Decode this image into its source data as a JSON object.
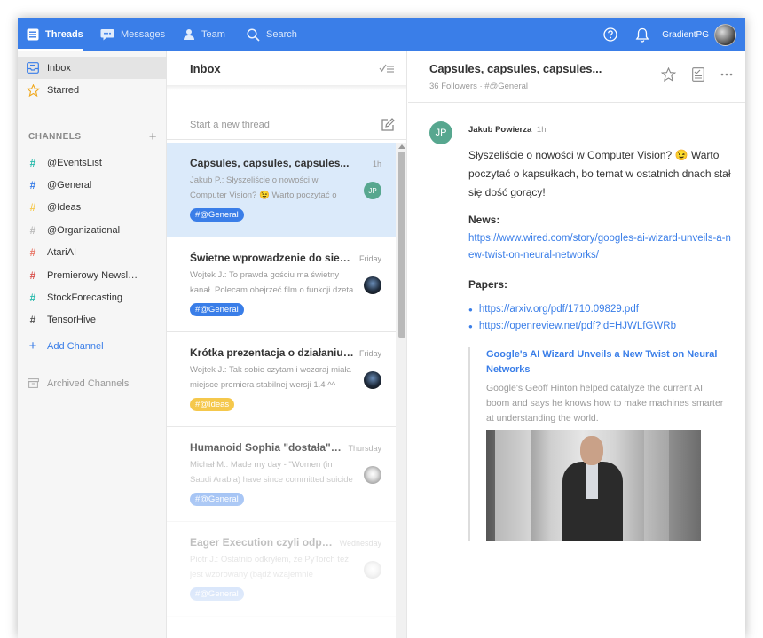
{
  "topbar": {
    "nav": [
      {
        "label": "Threads",
        "icon": "threads-icon",
        "active": true
      },
      {
        "label": "Messages",
        "icon": "messages-icon",
        "active": false
      },
      {
        "label": "Team",
        "icon": "team-icon",
        "active": false
      },
      {
        "label": "Search",
        "icon": "search-icon",
        "active": false
      }
    ],
    "user_name": "GradientPG",
    "icons": [
      "help-icon",
      "bell-icon",
      "avatar"
    ]
  },
  "sidebar": {
    "inbox": "Inbox",
    "starred": "Starred",
    "channels_header": "CHANNELS",
    "channels": [
      {
        "name": "@EventsList",
        "color": "#2bbbad"
      },
      {
        "name": "@General",
        "color": "#3a7ee8"
      },
      {
        "name": "@Ideas",
        "color": "#f5c84c"
      },
      {
        "name": "@Organizational",
        "color": "#bbbbbb"
      },
      {
        "name": "AtariAI",
        "color": "#e8796a"
      },
      {
        "name": "Premierowy Newsl…",
        "color": "#d9534f"
      },
      {
        "name": "StockForecasting",
        "color": "#2bbbad"
      },
      {
        "name": "TensorHive",
        "color": "#555555"
      }
    ],
    "add_channel": "Add Channel",
    "archived": "Archived Channels"
  },
  "threadlist": {
    "title": "Inbox",
    "new_thread_placeholder": "Start a new thread",
    "threads": [
      {
        "title": "Capsules, capsules, capsules...",
        "time": "1h",
        "preview_a": "Jakub P.: Słyszeliście o nowości w Computer Vision?",
        "emoji": "😉",
        "preview_b": " Warto poczytać o",
        "tag": "#@General",
        "avatar": "JP"
      },
      {
        "title": "Świetne wprowadzenie do sieci …",
        "time": "Friday",
        "preview_a": "Wojtek J.: To prawda gościu ma świetny kanał. Polecam obejrzeć film o funkcji dzeta",
        "tag": "#@General"
      },
      {
        "title": "Krótka prezentacja o działaniu TF",
        "time": "Friday",
        "preview_a": "Wojtek J.: Tak sobie czytam i wczoraj miała miejsce premiera stabilnej wersji 1.4 ^^",
        "tag": "#@Ideas"
      },
      {
        "title": "Humanoid Sophia \"dostała\" …",
        "time": "Thursday",
        "preview_a": "Michał M.: Made my day - \"Women (in Saudi Arabia) have since committed suicide",
        "tag": "#@General"
      },
      {
        "title": "Eager Execution czyli odpo…",
        "time": "Wednesday",
        "preview_a": "Piotr J.: Ostatnio odkryłem, że PyTorch też jest wzorowany (bądź wzajemnie",
        "tag": "#@General"
      }
    ]
  },
  "detail": {
    "title": "Capsules, capsules, capsules...",
    "followers": "36 Followers · #@General",
    "message": {
      "avatar": "JP",
      "author": "Jakub Powierza",
      "time": "1h",
      "text_a": "Słyszeliście o nowości w Computer Vision?",
      "emoji": "😉",
      "text_b": " Warto poczytać o kapsułkach, bo temat w ostatnich dnach stał się dość gorący!",
      "news_title": "News:",
      "news_link": "https://www.wired.com/story/googles-ai-wizard-unveils-a-new-twist-on-neural-networks/",
      "papers_title": "Papers:",
      "papers": [
        "https://arxiv.org/pdf/1710.09829.pdf",
        "https://openreview.net/pdf?id=HJWLfGWRb"
      ],
      "preview_title": "Google's AI Wizard Unveils a New Twist on Neural Networks",
      "preview_desc": "Google's Geoff Hinton helped catalyze the current AI boom and says he knows how to make machines smarter at understanding the world."
    }
  }
}
